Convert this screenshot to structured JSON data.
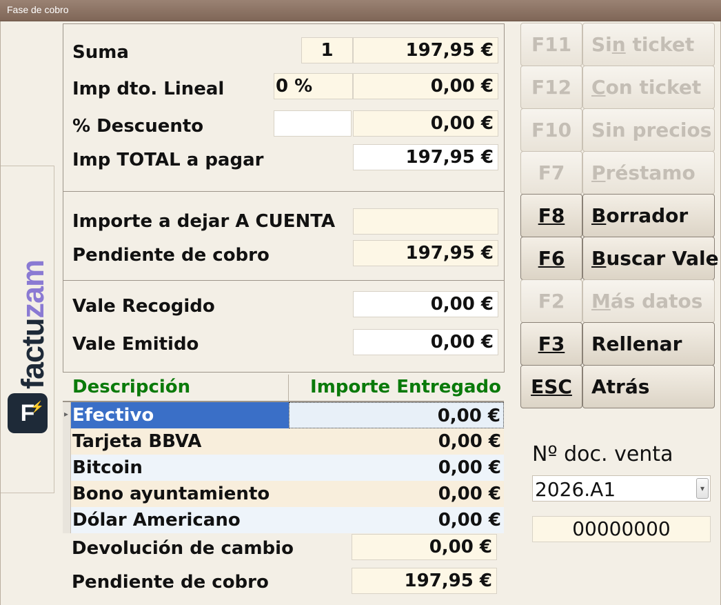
{
  "window": {
    "title": "Fase de cobro"
  },
  "logo": {
    "word_a": "factu",
    "word_b": "zam",
    "badge": "F"
  },
  "summary": {
    "suma_label": "Suma",
    "suma_qty": "1",
    "suma_amount": "197,95 €",
    "dto_lineal_label": "Imp dto. Lineal",
    "dto_lineal_pct": "0 %",
    "dto_lineal_amount": "0,00 €",
    "descuento_label": "% Descuento",
    "descuento_pct": "",
    "descuento_amount": "0,00 €",
    "total_label": "Imp TOTAL a pagar",
    "total_amount": "197,95 €"
  },
  "account": {
    "a_cuenta_label": "Importe a dejar A CUENTA",
    "a_cuenta_value": "",
    "pendiente_label": "Pendiente de cobro",
    "pendiente_value": "197,95 €"
  },
  "vales": {
    "recogido_label": "Vale Recogido",
    "recogido_value": "0,00 €",
    "emitido_label": "Vale Emitido",
    "emitido_value": "0,00 €"
  },
  "payments": {
    "col_desc": "Descripción",
    "col_amount": "Importe Entregado",
    "rows": [
      {
        "desc": "Efectivo",
        "amount": "0,00 €"
      },
      {
        "desc": "Tarjeta BBVA",
        "amount": "0,00 €"
      },
      {
        "desc": "Bitcoin",
        "amount": "0,00 €"
      },
      {
        "desc": "Bono ayuntamiento",
        "amount": "0,00 €"
      },
      {
        "desc": "Dólar Americano",
        "amount": "0,00 €"
      }
    ]
  },
  "footer": {
    "devolucion_label": "Devolución de cambio",
    "devolucion_value": "0,00 €",
    "pendiente_label": "Pendiente de cobro",
    "pendiente_value": "197,95 €"
  },
  "buttons": [
    {
      "key": "F11",
      "pre": "Si",
      "u": "n",
      "post": " ticket",
      "enabled": false
    },
    {
      "key": "F12",
      "pre": "",
      "u": "C",
      "post": "on ticket",
      "enabled": false
    },
    {
      "key": "F10",
      "pre": "Sin precios",
      "u": "",
      "post": "",
      "enabled": false
    },
    {
      "key": "F7",
      "pre": "",
      "u": "P",
      "post": "réstamo",
      "enabled": false
    },
    {
      "key": "F8",
      "pre": "",
      "u": "B",
      "post": "orrador",
      "enabled": true
    },
    {
      "key": "F6",
      "pre": "",
      "u": "B",
      "post": "uscar Vale",
      "enabled": true
    },
    {
      "key": "F2",
      "pre": "",
      "u": "M",
      "post": "ás datos",
      "enabled": false
    },
    {
      "key": "F3",
      "pre": "Rellenar",
      "u": "",
      "post": "",
      "enabled": true
    },
    {
      "key": "ESC",
      "pre": "Atrás",
      "u": "",
      "post": "",
      "enabled": true
    }
  ],
  "doc": {
    "label": "Nº doc. venta",
    "series": "2026.A1",
    "number": "00000000"
  }
}
